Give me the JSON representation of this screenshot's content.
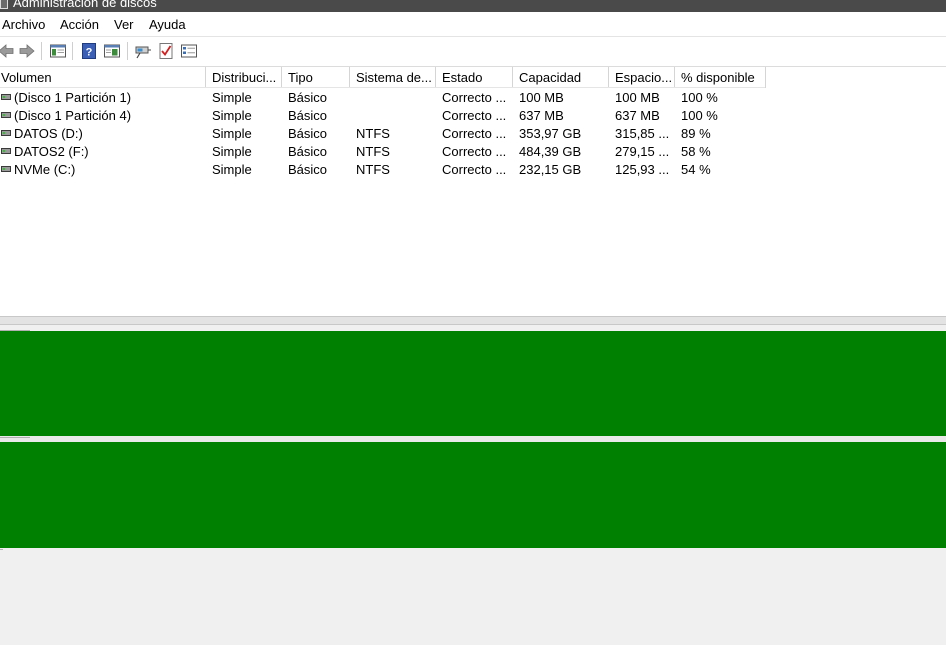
{
  "window": {
    "title": "Administración de discos"
  },
  "menu": [
    "Archivo",
    "Acción",
    "Ver",
    "Ayuda"
  ],
  "toolbar": {
    "buttons": [
      "back-icon",
      "forward-icon",
      "show-hide-console-tree-icon",
      "help-icon",
      "properties-icon",
      "connect-icon",
      "checkmark-icon",
      "settings-list-icon"
    ]
  },
  "colors": {
    "disk_partition": "#008000",
    "titlebar": "#4a4a4a"
  },
  "volume_table": {
    "columns": [
      "Volumen",
      "Distribuci...",
      "Tipo",
      "Sistema de...",
      "Estado",
      "Capacidad",
      "Espacio...",
      "% disponible"
    ],
    "rows": [
      [
        "(Disco 1 Partición 1)",
        "Simple",
        "Básico",
        "",
        "Correcto ...",
        "100 MB",
        "100 MB",
        "100 %"
      ],
      [
        "(Disco 1 Partición 4)",
        "Simple",
        "Básico",
        "",
        "Correcto ...",
        "637 MB",
        "637 MB",
        "100 %"
      ],
      [
        "DATOS (D:)",
        "Simple",
        "Básico",
        "NTFS",
        "Correcto ...",
        "353,97 GB",
        "315,85 ...",
        "89 %"
      ],
      [
        "DATOS2 (F:)",
        "Simple",
        "Básico",
        "NTFS",
        "Correcto ...",
        "484,39 GB",
        "279,15 ...",
        "58 %"
      ],
      [
        "NVMe (C:)",
        "Simple",
        "Básico",
        "NTFS",
        "Correcto ...",
        "232,15 GB",
        "125,93 ...",
        "54 %"
      ]
    ]
  }
}
